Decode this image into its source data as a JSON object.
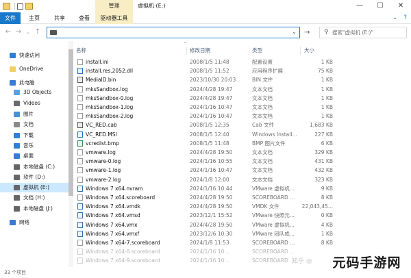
{
  "window": {
    "manage_tab": "管理",
    "title": "虚拟机 (E:)",
    "minimize_glyph": "—",
    "maximize_glyph": "☐",
    "close_glyph": "✕"
  },
  "ribbon": {
    "tabs": [
      "文件",
      "主页",
      "共享",
      "查看"
    ],
    "tool_tab": "驱动器工具",
    "expand_glyph": "⌄",
    "help_glyph": "?"
  },
  "address": {
    "value": "",
    "search_placeholder": "搜索\"虚拟机 (E:)\"",
    "back_glyph": "←",
    "forward_glyph": "→",
    "dropdown_glyph": "⌄",
    "up_glyph": "↑",
    "refresh_glyph": "→",
    "search_glyph": "⚲"
  },
  "nav": {
    "items": [
      {
        "label": "快速访问",
        "icon": "star-icon",
        "color": "#2f7fd6"
      },
      {
        "label": "OneDrive",
        "icon": "folder-icon",
        "color": "#f2cf62"
      },
      {
        "label": "此电脑",
        "icon": "computer-icon",
        "color": "#3a7bd5"
      },
      {
        "label": "3D Objects",
        "icon": "cube-icon",
        "color": "#5aa0e6"
      },
      {
        "label": "Videos",
        "icon": "video-icon",
        "color": "#6a6a6a"
      },
      {
        "label": "图片",
        "icon": "picture-icon",
        "color": "#4a90d9"
      },
      {
        "label": "文档",
        "icon": "document-icon",
        "color": "#8a8a8a"
      },
      {
        "label": "下载",
        "icon": "download-icon",
        "color": "#2f7fd6"
      },
      {
        "label": "音乐",
        "icon": "music-icon",
        "color": "#2f7fd6"
      },
      {
        "label": "桌面",
        "icon": "desktop-icon",
        "color": "#3a7bd5"
      },
      {
        "label": "本地磁盘 (C:)",
        "icon": "drive-icon",
        "color": "#666666"
      },
      {
        "label": "软件 (D:)",
        "icon": "drive-icon",
        "color": "#666666"
      },
      {
        "label": "虚拟机 (E:)",
        "icon": "drive-icon",
        "color": "#666666"
      },
      {
        "label": "文档 (H:)",
        "icon": "drive-icon",
        "color": "#666666"
      },
      {
        "label": "本地磁盘 (J:)",
        "icon": "drive-icon",
        "color": "#666666"
      },
      {
        "label": "网络",
        "icon": "network-icon",
        "color": "#3a7bd5"
      }
    ]
  },
  "filelist": {
    "headers": {
      "name": "名称",
      "date": "修改日期",
      "type": "类型",
      "size": "大小"
    },
    "rows": [
      {
        "name": "install.ini",
        "date": "2008/1/5 11:48",
        "type": "配置设置",
        "size": "1 KB",
        "icon": "config-icon"
      },
      {
        "name": "install.res.2052.dll",
        "date": "2008/1/5 11:52",
        "type": "应用程序扩展",
        "size": "75 KB",
        "icon": "dll-icon"
      },
      {
        "name": "MediaID.bin",
        "date": "2023/10/30 20:03",
        "type": "BIN 文件",
        "size": "1 KB",
        "icon": "bin-icon"
      },
      {
        "name": "mksSandbox.log",
        "date": "2024/4/28 19:47",
        "type": "文本文档",
        "size": "1 KB",
        "icon": "text-file-icon"
      },
      {
        "name": "mksSandbox-0.log",
        "date": "2024/4/28 19:47",
        "type": "文本文档",
        "size": "1 KB",
        "icon": "text-file-icon"
      },
      {
        "name": "mksSandbox-1.log",
        "date": "2024/1/16 10:47",
        "type": "文本文档",
        "size": "1 KB",
        "icon": "text-file-icon"
      },
      {
        "name": "mksSandbox-2.log",
        "date": "2024/1/16 10:47",
        "type": "文本文档",
        "size": "1 KB",
        "icon": "text-file-icon"
      },
      {
        "name": "VC_RED.cab",
        "date": "2008/1/5 12:35",
        "type": "Cab 文件",
        "size": "1,683 KB",
        "icon": "cab-icon"
      },
      {
        "name": "VC_RED.MSI",
        "date": "2008/1/5 12:40",
        "type": "Windows Install...",
        "size": "227 KB",
        "icon": "msi-icon"
      },
      {
        "name": "vcredist.bmp",
        "date": "2008/1/5 11:48",
        "type": "BMP 图片文件",
        "size": "6 KB",
        "icon": "image-file-icon"
      },
      {
        "name": "vmware.log",
        "date": "2024/4/28 19:50",
        "type": "文本文档",
        "size": "329 KB",
        "icon": "text-file-icon"
      },
      {
        "name": "vmware-0.log",
        "date": "2024/1/16 10:55",
        "type": "文本文档",
        "size": "431 KB",
        "icon": "text-file-icon"
      },
      {
        "name": "vmware-1.log",
        "date": "2024/1/16 10:47",
        "type": "文本文档",
        "size": "432 KB",
        "icon": "text-file-icon"
      },
      {
        "name": "vmware-2.log",
        "date": "2024/1/8 12:00",
        "type": "文本文档",
        "size": "323 KB",
        "icon": "text-file-icon"
      },
      {
        "name": "Windows 7 x64.nvram",
        "date": "2024/1/16 10:44",
        "type": "VMware 虚拟机...",
        "size": "9 KB",
        "icon": "vm-file-icon"
      },
      {
        "name": "Windows 7 x64.scoreboard",
        "date": "2024/4/28 19:50",
        "type": "SCOREBOARD ...",
        "size": "8 KB",
        "icon": "text-file-icon"
      },
      {
        "name": "Windows 7 x64.vmdk",
        "date": "2024/4/28 19:50",
        "type": "VMDK 文件",
        "size": "22,043,45...",
        "icon": "vm-file-icon"
      },
      {
        "name": "Windows 7 x64.vmsd",
        "date": "2023/12/1 15:52",
        "type": "VMware 快照元...",
        "size": "0 KB",
        "icon": "vm-file-icon"
      },
      {
        "name": "Windows 7 x64.vmx",
        "date": "2024/4/28 19:50",
        "type": "VMware 虚拟机...",
        "size": "4 KB",
        "icon": "vm-file-icon"
      },
      {
        "name": "Windows 7 x64.vmxf",
        "date": "2023/12/6 10:30",
        "type": "VMware 团队成...",
        "size": "1 KB",
        "icon": "vm-file-icon"
      },
      {
        "name": "Windows 7 x64-7.scoreboard",
        "date": "2024/1/8 11:53",
        "type": "SCOREBOARD ...",
        "size": "8 KB",
        "icon": "text-file-icon"
      },
      {
        "name": "Windows 7 x64-8.scoreboard",
        "date": "2024/1/16 10:..",
        "type": "SCOREBOARD ...",
        "size": "",
        "icon": "text-file-icon",
        "faded": true
      },
      {
        "name": "Windows 7 x64-9.scoreboard",
        "date": "2024/1/16 10:..",
        "type": "SCOREBOARD ...",
        "size": "",
        "icon": "text-file-icon",
        "faded": true
      }
    ]
  },
  "status": {
    "item_count": "33 个项目"
  },
  "watermark": {
    "site": "知乎 @",
    "logo_text": "元码手游网"
  }
}
